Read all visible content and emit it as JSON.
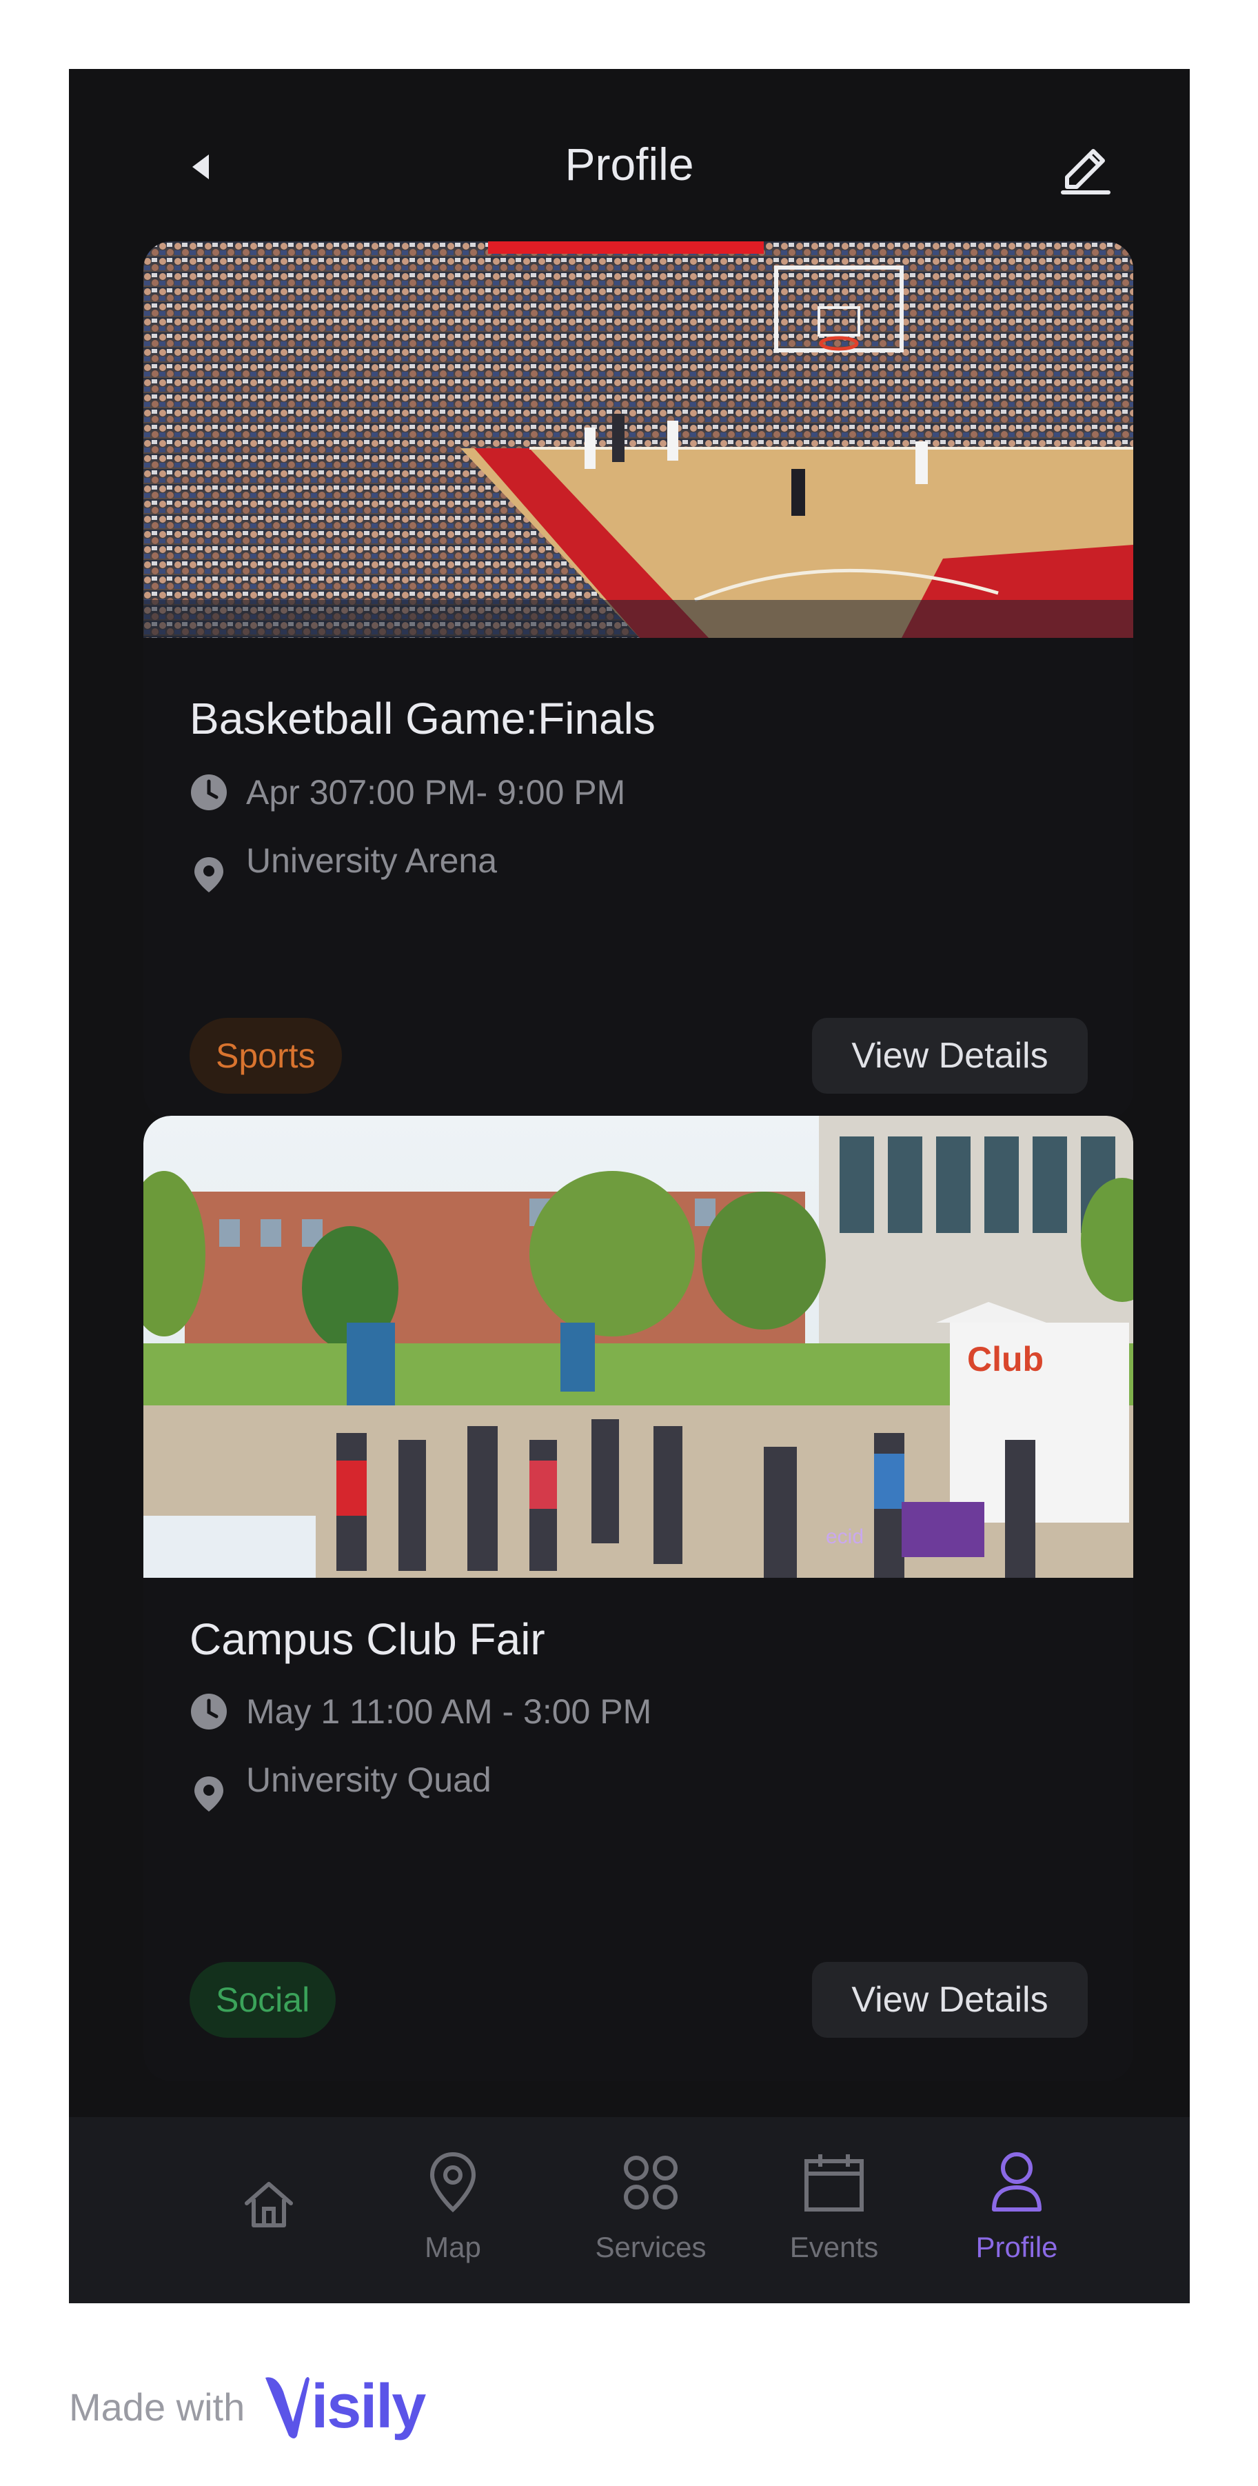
{
  "header": {
    "title": "Profile"
  },
  "events": [
    {
      "title": "Basketball Game:Finals",
      "datetime": "Apr 307:00 PM- 9:00 PM",
      "location": "University Arena",
      "tag": "Sports",
      "action": "View Details",
      "image": "basketball-arena-photo"
    },
    {
      "title": "Campus Club Fair",
      "datetime": "May 1  11:00 AM - 3:00 PM",
      "location": "University Quad",
      "tag": "Social",
      "action": "View Details",
      "image": "campus-club-fair-photo",
      "image_signs": {
        "booth": "Club",
        "banner": "ecid"
      }
    }
  ],
  "tabs": [
    {
      "label": "",
      "icon": "home-icon"
    },
    {
      "label": "Map",
      "icon": "map-pin-icon"
    },
    {
      "label": "Services",
      "icon": "services-grid-icon"
    },
    {
      "label": "Events",
      "icon": "calendar-icon"
    },
    {
      "label": "Profile",
      "icon": "user-icon",
      "active": true
    }
  ],
  "footer": {
    "made_with": "Made with",
    "brand": "isily"
  },
  "colors": {
    "background": "#121214",
    "accent": "#8b6ae6",
    "sports_chip_text": "#d9742f",
    "social_chip_text": "#3ba35a",
    "brand": "#5b54e8"
  }
}
